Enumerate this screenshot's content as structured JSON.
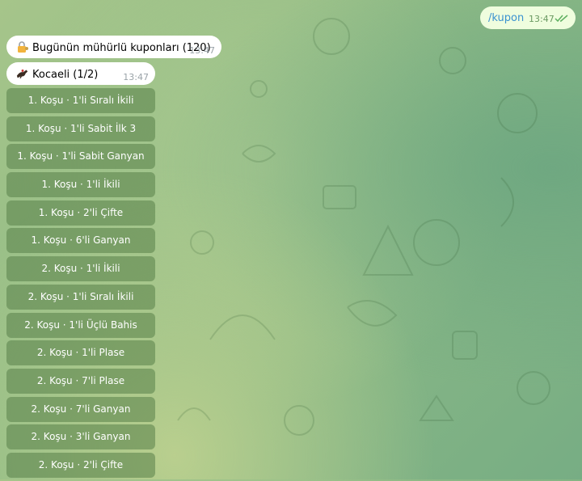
{
  "messages": {
    "outgoing": {
      "text": "/kupon",
      "time": "13:47",
      "status_icon": "double-check-icon"
    },
    "incoming": [
      {
        "emoji": "lock-with-key-icon",
        "text": "Bugünün mühürlü kuponları (120)",
        "time": "13:47"
      },
      {
        "emoji": "horse-racing-icon",
        "text": "Kocaeli (1/2)",
        "time": "13:47"
      }
    ]
  },
  "keyboard": {
    "buttons": [
      "1. Koşu · 1'li Sıralı İkili",
      "1. Koşu · 1'li Sabit İlk 3",
      "1. Koşu · 1'li Sabit Ganyan",
      "1. Koşu · 1'li İkili",
      "1. Koşu · 2'li Çifte",
      "1. Koşu · 6'li Ganyan",
      "2. Koşu · 1'li İkili",
      "2. Koşu · 1'li Sıralı İkili",
      "2. Koşu · 1'li Üçlü Bahis",
      "2. Koşu · 1'li Plase",
      "2. Koşu · 7'li Plase",
      "2. Koşu · 7'li Ganyan",
      "2. Koşu · 3'li Ganyan",
      "2. Koşu · 2'li Çifte"
    ]
  },
  "colors": {
    "outgoing_bubble": "#effdde",
    "command_link": "#3a92d0",
    "button_bg": "rgba(88,128,72,0.55)"
  }
}
